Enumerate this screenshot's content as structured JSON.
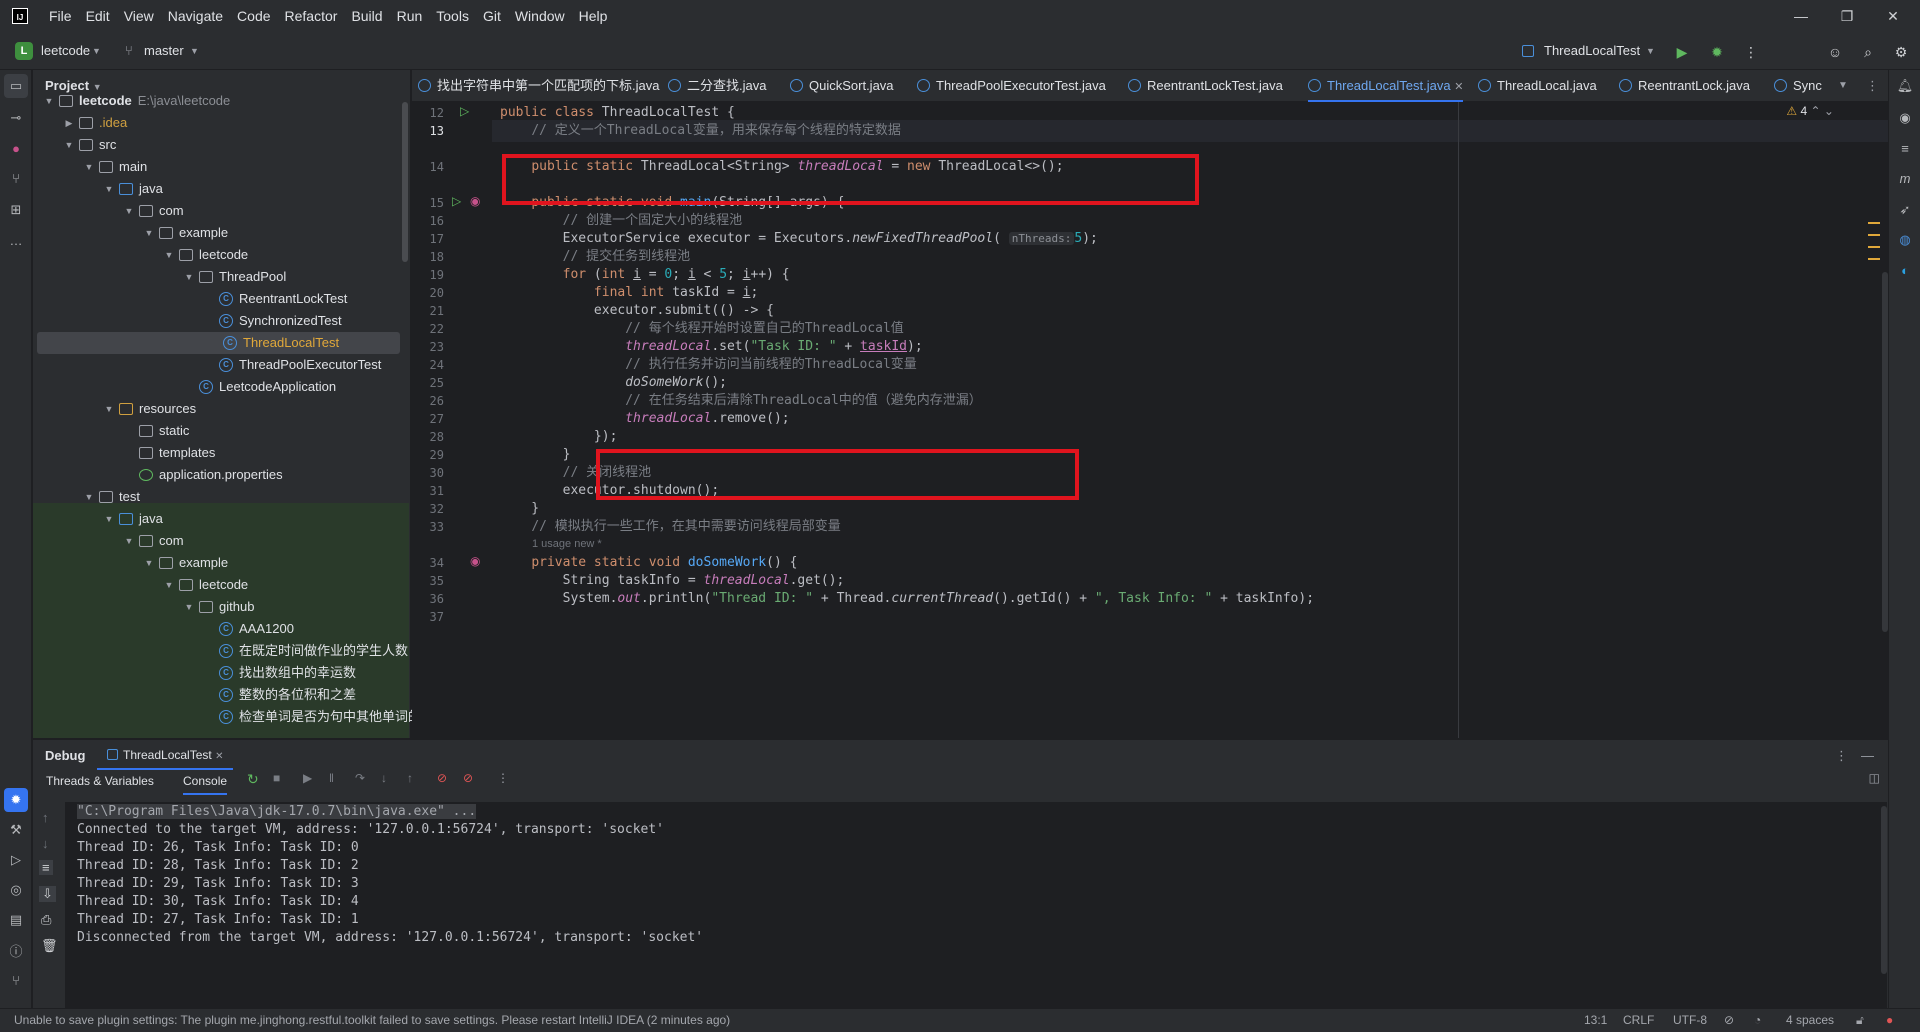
{
  "menu": [
    "File",
    "Edit",
    "View",
    "Navigate",
    "Code",
    "Refactor",
    "Build",
    "Run",
    "Tools",
    "Git",
    "Window",
    "Help"
  ],
  "toolbar": {
    "project_badge": "L",
    "project": "leetcode",
    "branch": "master",
    "run_config": "ThreadLocalTest"
  },
  "project_panel": {
    "title": "Project",
    "root_label": "leetcode",
    "root_path": "E:\\java\\leetcode",
    "items": [
      ".idea",
      "src",
      "main",
      "java",
      "com",
      "example",
      "leetcode",
      "ThreadPool",
      "ReentrantLockTest",
      "SynchronizedTest",
      "ThreadLocalTest",
      "ThreadPoolExecutorTest",
      "LeetcodeApplication",
      "resources",
      "static",
      "templates",
      "application.properties",
      "test",
      "java",
      "com",
      "example",
      "leetcode",
      "github",
      "AAA1200",
      "在既定时间做作业的学生人数",
      "找出数组中的幸运数",
      "整数的各位积和之差",
      "检查单词是否为句中其他单词的前缀"
    ]
  },
  "tabs": [
    "找出字符串中第一个匹配项的下标.java",
    "二分查找.java",
    "QuickSort.java",
    "ThreadPoolExecutorTest.java",
    "ReentrantLockTest.java",
    "ThreadLocalTest.java",
    "ThreadLocal.java",
    "ReentrantLock.java",
    "Sync"
  ],
  "editor": {
    "warnings": "4",
    "line_numbers": [
      "12",
      "13",
      "14",
      "15",
      "16",
      "17",
      "18",
      "19",
      "20",
      "21",
      "22",
      "23",
      "24",
      "25",
      "26",
      "27",
      "28",
      "29",
      "30",
      "31",
      "32",
      "33",
      "34",
      "35",
      "36",
      "37"
    ],
    "usage_hint": "1 usage  new *",
    "param_hint": "nThreads:",
    "comments": {
      "c13": "// 定义一个ThreadLocal变量，用来保存每个线程的特定数据",
      "c16": "// 创建一个固定大小的线程池",
      "c18": "// 提交任务到线程池",
      "c22": "// 每个线程开始时设置自己的ThreadLocal值",
      "c24": "// 执行任务并访问当前线程的ThreadLocal变量",
      "c26": "// 在任务结束后清除ThreadLocal中的值（避免内存泄漏）",
      "c30": "// 关闭线程池",
      "c33": "// 模拟执行一些工作，在其中需要访问线程局部变量"
    }
  },
  "debug": {
    "title": "Debug",
    "session": "ThreadLocalTest",
    "tab_threads": "Threads & Variables",
    "tab_console": "Console",
    "console_lines": [
      "\"C:\\Program Files\\Java\\jdk-17.0.7\\bin\\java.exe\" ...",
      "Connected to the target VM, address: '127.0.0.1:56724', transport: 'socket'",
      "Thread ID: 26, Task Info: Task ID: 0",
      "Thread ID: 28, Task Info: Task ID: 2",
      "Thread ID: 29, Task Info: Task ID: 3",
      "Thread ID: 30, Task Info: Task ID: 4",
      "Thread ID: 27, Task Info: Task ID: 1",
      "Disconnected from the target VM, address: '127.0.0.1:56724', transport: 'socket'"
    ]
  },
  "status": {
    "message": "Unable to save plugin settings: The plugin me.jinghong.restful.toolkit failed to save settings. Please restart IntelliJ IDEA (2 minutes ago)",
    "position": "13:1",
    "line_sep": "CRLF",
    "encoding": "UTF-8",
    "indent": "4 spaces"
  }
}
